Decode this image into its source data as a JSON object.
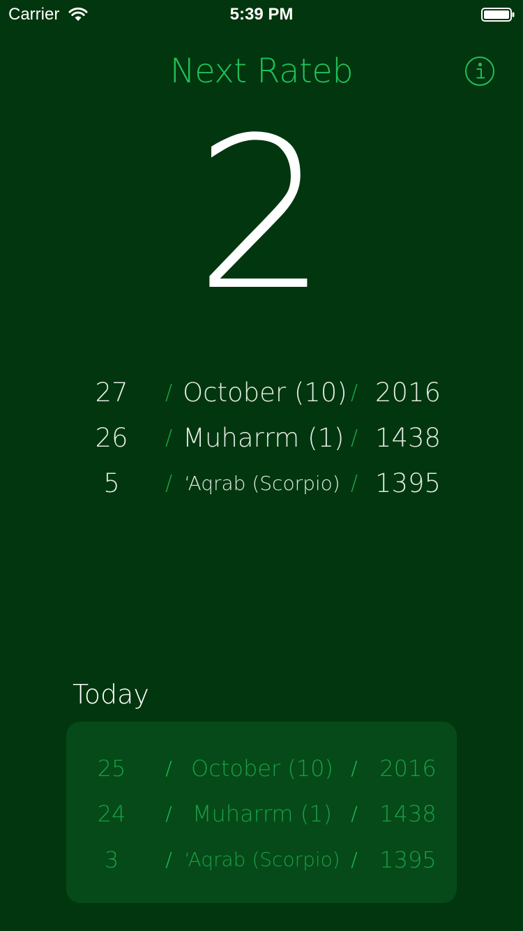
{
  "status_bar": {
    "carrier": "Carrier",
    "time": "5:39 PM",
    "icons": [
      "wifi-icon",
      "battery-icon"
    ]
  },
  "header": {
    "title": "Next Rateb",
    "info_icon": "info-icon"
  },
  "countdown": {
    "value": "2"
  },
  "next_dates": [
    {
      "day": "27",
      "sep1": "/",
      "month": "October (10)",
      "sep2": "/",
      "year": "2016"
    },
    {
      "day": "26",
      "sep1": "/",
      "month": "Muharrm (1)",
      "sep2": "/",
      "year": "1438"
    },
    {
      "day": "5",
      "sep1": "/",
      "month": "‘Aqrab (Scorpio)",
      "sep2": "/",
      "year": "1395"
    }
  ],
  "today": {
    "label": "Today",
    "dates": [
      {
        "day": "25",
        "sep1": "/",
        "month": "October (10)",
        "sep2": "/",
        "year": "2016"
      },
      {
        "day": "24",
        "sep1": "/",
        "month": "Muharrm (1)",
        "sep2": "/",
        "year": "1438"
      },
      {
        "day": "3",
        "sep1": "/",
        "month": "‘Aqrab (Scorpio)",
        "sep2": "/",
        "year": "1395"
      }
    ]
  },
  "colors": {
    "background": "#02360e",
    "accent": "#1fc05a",
    "card": "#054a18",
    "today_text": "#1c9e48"
  }
}
